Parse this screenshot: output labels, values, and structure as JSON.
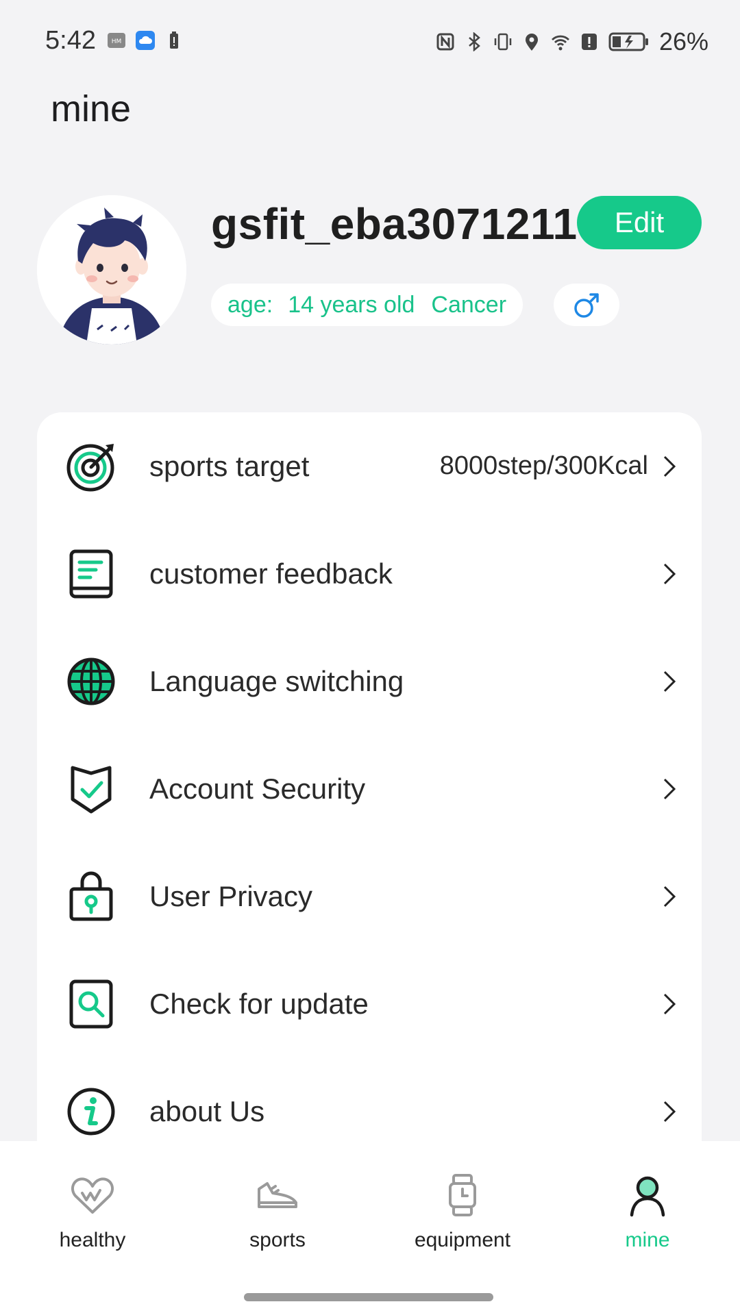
{
  "status_bar": {
    "time": "5:42",
    "battery": "26%",
    "left_icons": [
      "harmony-os-icon",
      "cloud-icon",
      "battery-alert-icon"
    ],
    "right_icons": [
      "nfc-icon",
      "bluetooth-icon",
      "vibrate-icon",
      "location-icon",
      "wifi-icon",
      "alert-icon",
      "battery-charging-icon"
    ]
  },
  "header": {
    "title": "mine"
  },
  "profile": {
    "username": "gsfit_eba3071211",
    "edit_label": "Edit",
    "age_label": "age:",
    "age_value": "14 years old",
    "zodiac": "Cancer",
    "gender_icon": "male-symbol-icon"
  },
  "menu": {
    "items": [
      {
        "label": "sports target",
        "value": "8000step/300Kcal",
        "icon": "target-icon"
      },
      {
        "label": "customer feedback",
        "value": "",
        "icon": "feedback-icon"
      },
      {
        "label": "Language switching",
        "value": "",
        "icon": "globe-icon"
      },
      {
        "label": "Account Security",
        "value": "",
        "icon": "shield-icon"
      },
      {
        "label": "User Privacy",
        "value": "",
        "icon": "lock-icon"
      },
      {
        "label": "Check for update",
        "value": "",
        "icon": "search-icon"
      },
      {
        "label": "about Us",
        "value": "",
        "icon": "info-icon"
      }
    ]
  },
  "bottom_nav": {
    "items": [
      {
        "label": "healthy",
        "icon": "heart-icon",
        "active": false
      },
      {
        "label": "sports",
        "icon": "sneaker-icon",
        "active": false
      },
      {
        "label": "equipment",
        "icon": "watch-icon",
        "active": false
      },
      {
        "label": "mine",
        "icon": "person-icon",
        "active": true
      }
    ]
  },
  "colors": {
    "accent": "#16c98a",
    "background": "#f3f3f5",
    "card": "#ffffff",
    "text": "#2a2a2a"
  }
}
